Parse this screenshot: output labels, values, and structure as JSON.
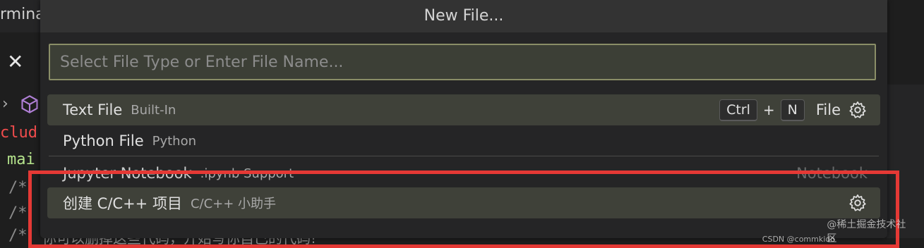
{
  "background": {
    "tab_fragment": "rmina",
    "code_lines": [
      "clud",
      "mai",
      "/*",
      "/*",
      "/*"
    ],
    "bottom_line_fragment": "你可以删掉这些代码，开始写你自己的代码!"
  },
  "quickpick": {
    "title": "New File...",
    "input_placeholder": "Select File Type or Enter File Name...",
    "items": [
      {
        "label": "Text File",
        "description": "Built-In",
        "key1": "Ctrl",
        "key_plus": "+",
        "key2": "N",
        "kind": "File"
      },
      {
        "label": "Python File",
        "description": "Python"
      },
      {
        "label": "Jupyter Notebook",
        "description": ".ipynb Support",
        "kind": "Notebook"
      },
      {
        "label": "创建 C/C++ 项目",
        "description": "C/C++ 小助手"
      }
    ]
  },
  "watermark": "@稀土掘金技术社区",
  "watermark_csdn": "CSDN @commkido",
  "colors": {
    "highlight": "#e53935",
    "active_row": "#3f4139",
    "input_border": "#8a8e67"
  }
}
